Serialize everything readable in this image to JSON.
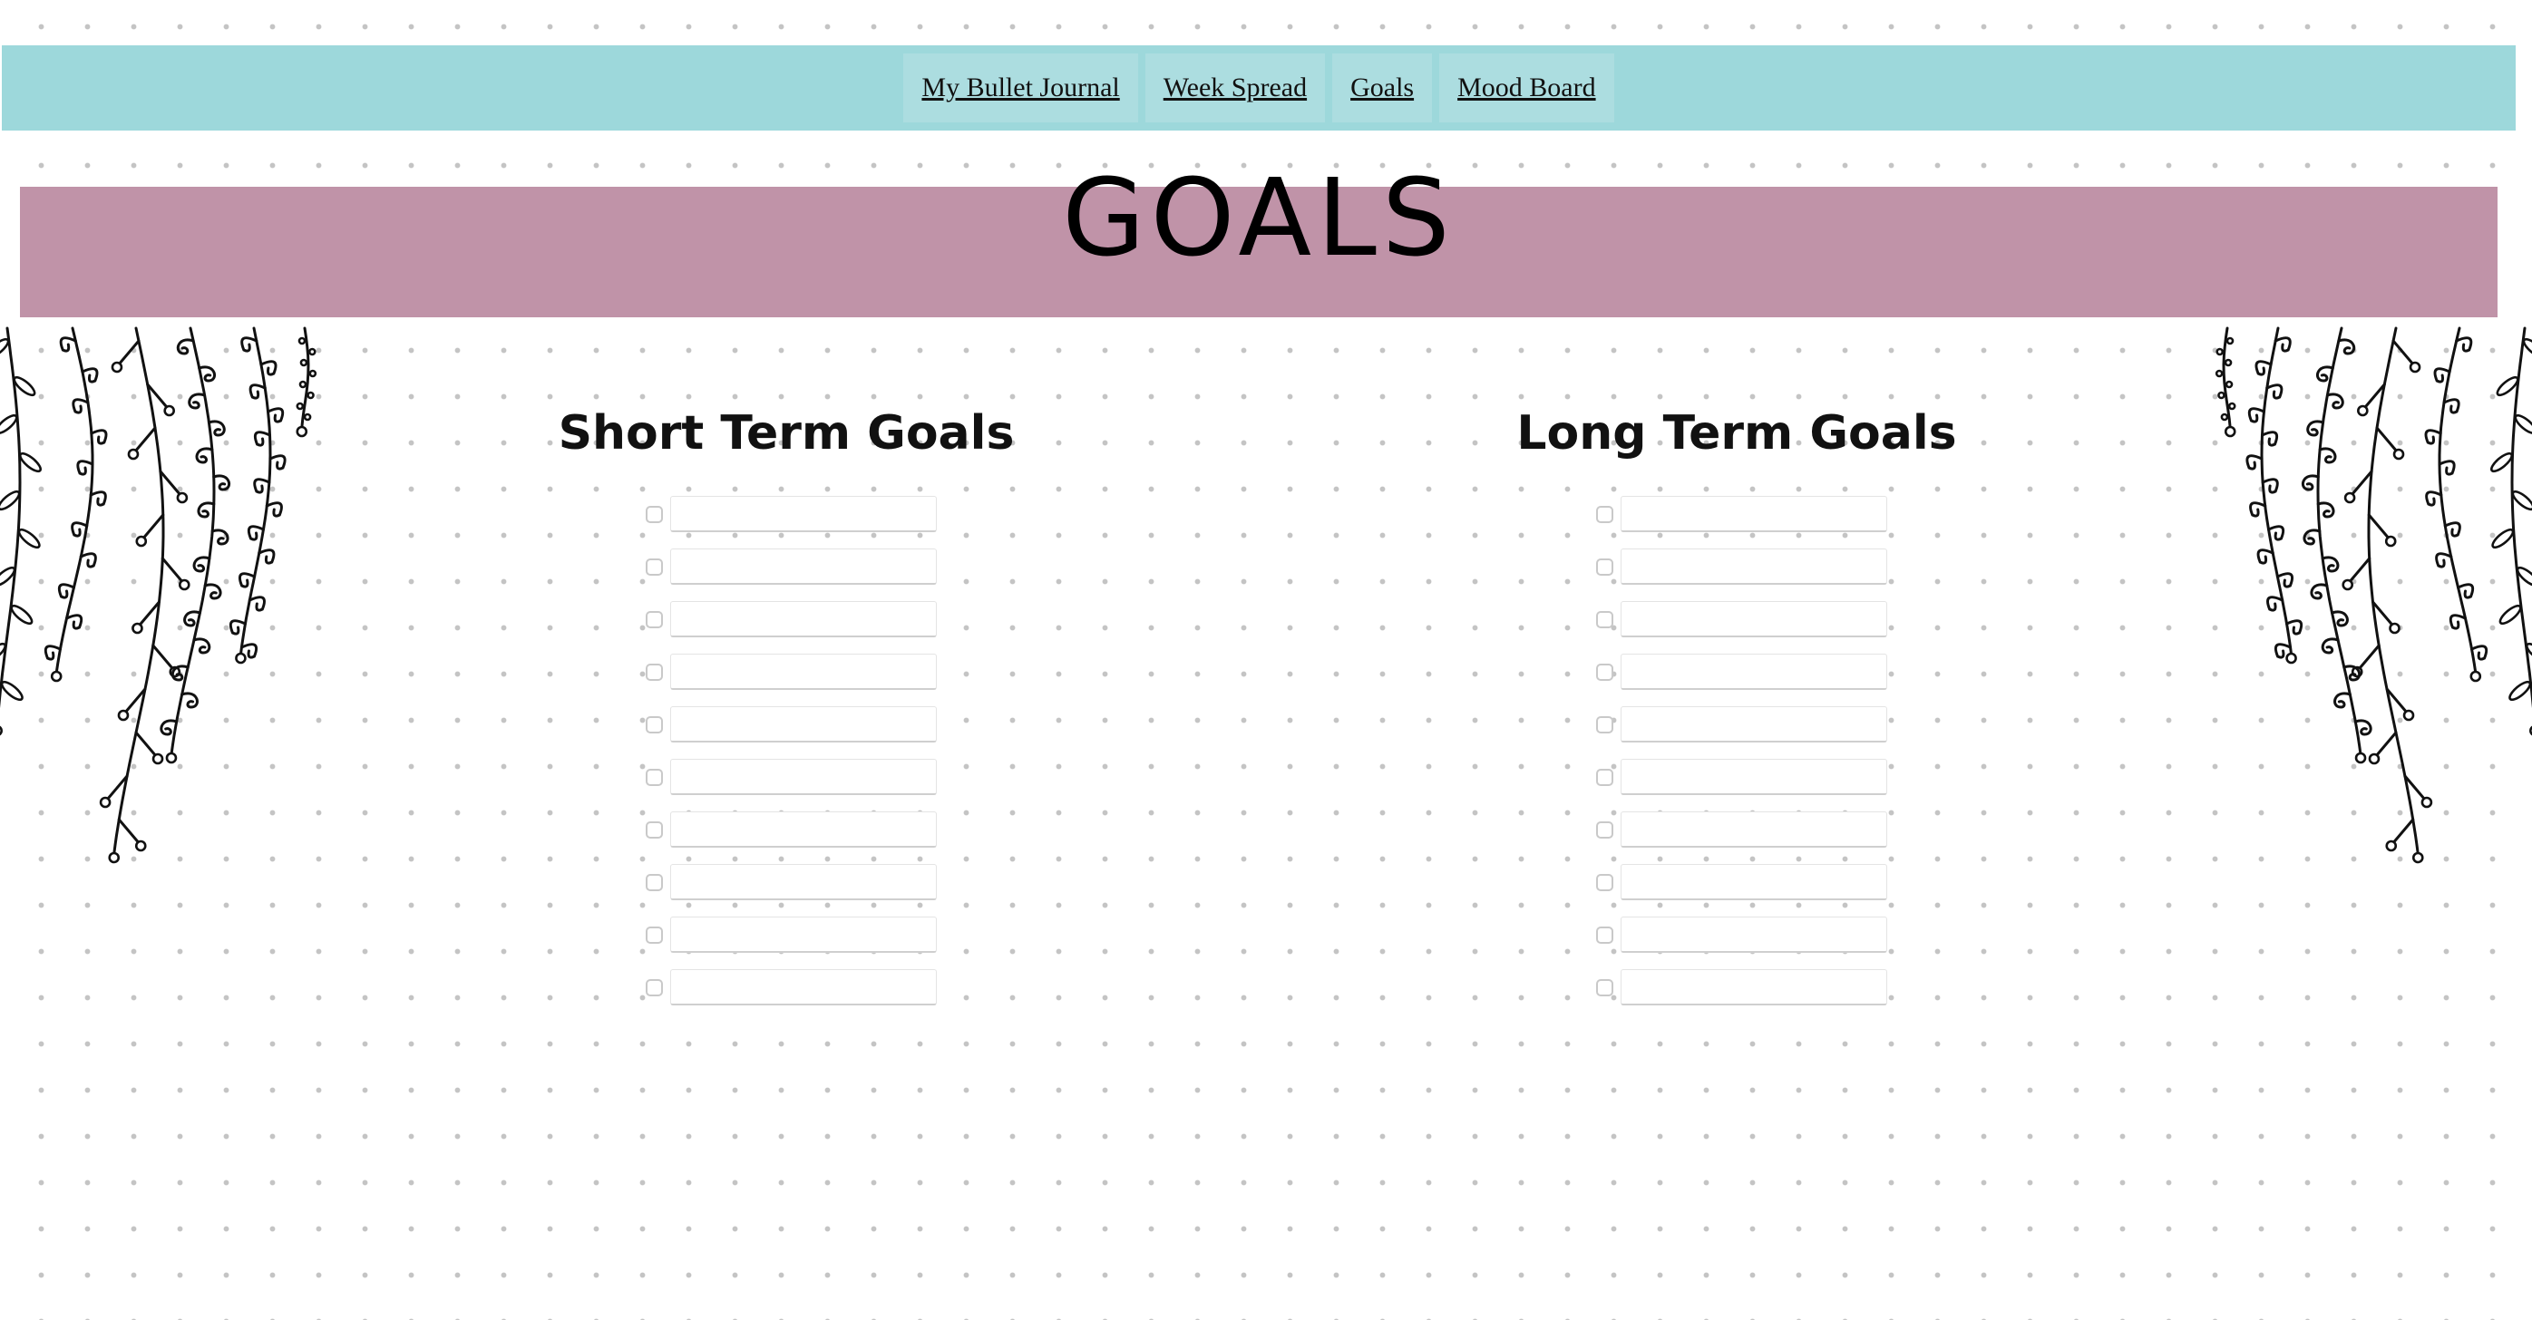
{
  "nav": {
    "items": [
      {
        "label": "My Bullet Journal"
      },
      {
        "label": "Week Spread"
      },
      {
        "label": "Goals"
      },
      {
        "label": "Mood Board"
      }
    ]
  },
  "page": {
    "title": "GOALS"
  },
  "sections": {
    "short_term": {
      "title": "Short Term Goals",
      "items": [
        {
          "checked": false,
          "value": ""
        },
        {
          "checked": false,
          "value": ""
        },
        {
          "checked": false,
          "value": ""
        },
        {
          "checked": false,
          "value": ""
        },
        {
          "checked": false,
          "value": ""
        },
        {
          "checked": false,
          "value": ""
        },
        {
          "checked": false,
          "value": ""
        },
        {
          "checked": false,
          "value": ""
        },
        {
          "checked": false,
          "value": ""
        },
        {
          "checked": false,
          "value": ""
        }
      ]
    },
    "long_term": {
      "title": "Long Term Goals",
      "items": [
        {
          "checked": false,
          "value": ""
        },
        {
          "checked": false,
          "value": ""
        },
        {
          "checked": false,
          "value": ""
        },
        {
          "checked": false,
          "value": ""
        },
        {
          "checked": false,
          "value": ""
        },
        {
          "checked": false,
          "value": ""
        },
        {
          "checked": false,
          "value": ""
        },
        {
          "checked": false,
          "value": ""
        },
        {
          "checked": false,
          "value": ""
        },
        {
          "checked": false,
          "value": ""
        }
      ]
    }
  },
  "decorations": {
    "left": "hanging-vines-illustration",
    "right": "hanging-vines-illustration"
  },
  "colors": {
    "nav_background": "#9dd8db",
    "nav_item_background": "#acdde0",
    "title_banner": "#c093a8",
    "dot_grid": "#c4c4c4"
  }
}
